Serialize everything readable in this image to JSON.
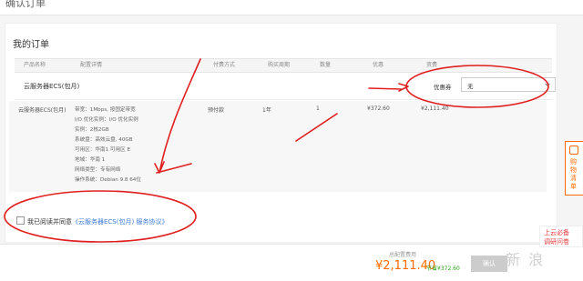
{
  "page": {
    "title": "确认订单"
  },
  "order": {
    "title": "我的订单",
    "headers": {
      "product": "产品名称",
      "config": "配置详情",
      "pay_method": "付费方式",
      "period": "购买周期",
      "qty": "数量",
      "discount": "优惠",
      "price": "资费"
    },
    "product_name": "云服务器ECS(包月)",
    "coupon": {
      "label": "优惠券",
      "value": "无"
    },
    "detail": {
      "name": "云服务器ECS(包月)",
      "specs": [
        "带宽：1Mbps, 按固定带宽",
        "I/O 优化实例：I/O 优化实例",
        "实例：2核2GB",
        "系统盘：高效云盘, 40GB",
        "可用区：华南1 可用区 E",
        "地域：华南 1",
        "网络类型：专有网络",
        "操作系统：Debian 9.8 64位"
      ],
      "pay_method": "预付款",
      "period": "1年",
      "qty": "1",
      "discount": "¥372.60",
      "price": "¥2,111.40"
    }
  },
  "agreement": {
    "prefix": "我已阅读并同意",
    "link": "《云服务器ECS(包月) 服务协议》"
  },
  "footer": {
    "total_label": "总配置费用",
    "total": "¥2,111.40",
    "saved": "节省¥372.60",
    "pay_button": "确认"
  },
  "sidebar": {
    "tab_text": "购物清单"
  },
  "promo": {
    "line1": "上云必备",
    "line2": "调研问卷"
  },
  "watermark": "新 浪",
  "colors": {
    "accent": "#ff6a00",
    "link": "#3a7bd5",
    "annotation": "#e02020"
  }
}
